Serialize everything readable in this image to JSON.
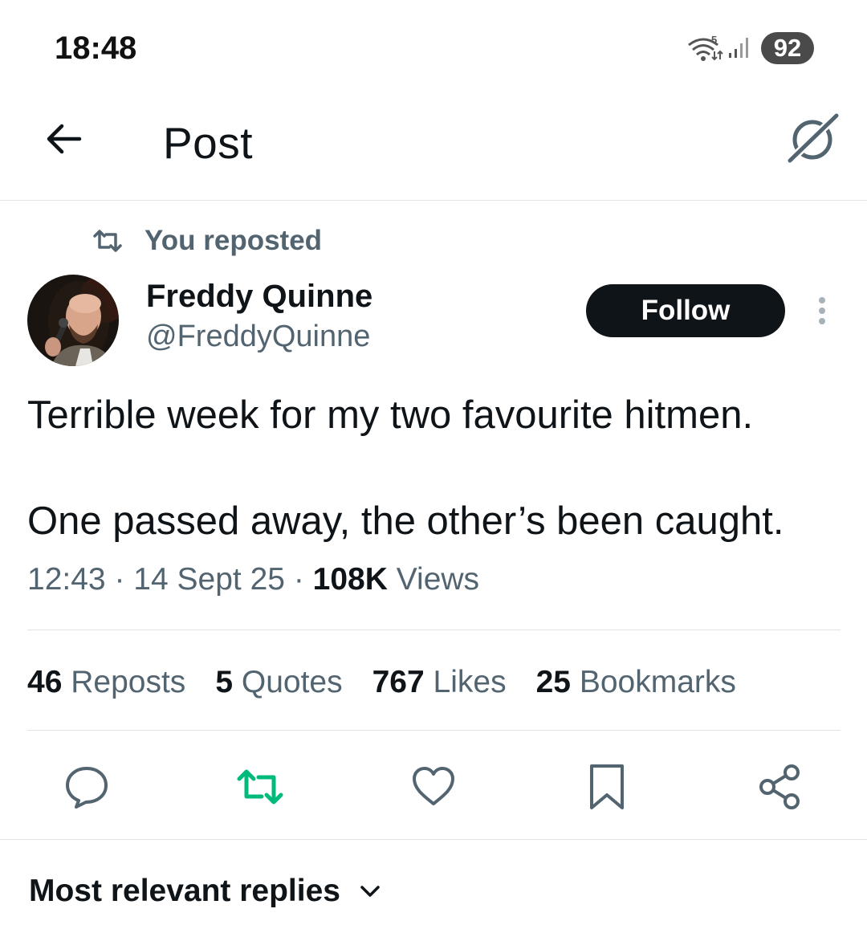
{
  "status_bar": {
    "time": "18:48",
    "wifi_badge": "5",
    "battery": "92"
  },
  "header": {
    "title": "Post",
    "back_icon": "arrow-left-icon",
    "grok_icon": "grok-icon"
  },
  "repost_context": {
    "label": "You reposted",
    "icon": "repost-icon"
  },
  "author": {
    "name": "Freddy Quinne",
    "handle": "@FreddyQuinne",
    "follow_label": "Follow"
  },
  "tweet": {
    "line1": "Terrible week for my two favourite hitmen.",
    "line2": "One passed away, the other’s been caught.",
    "time": "12:43",
    "separator": "·",
    "date": "14 Sept 25",
    "views_count": "108K",
    "views_label": "Views"
  },
  "stats": {
    "reposts_count": "46",
    "reposts_label": "Reposts",
    "quotes_count": "5",
    "quotes_label": "Quotes",
    "likes_count": "767",
    "likes_label": "Likes",
    "bookmarks_count": "25",
    "bookmarks_label": "Bookmarks"
  },
  "actions": [
    "reply-icon",
    "repost-icon",
    "like-icon",
    "bookmark-icon",
    "share-icon"
  ],
  "replies": {
    "sort_label": "Most relevant replies"
  },
  "colors": {
    "text_primary": "#0f1419",
    "text_secondary": "#536471",
    "repost_active": "#00ba7c",
    "divider": "#e1e4e6"
  }
}
